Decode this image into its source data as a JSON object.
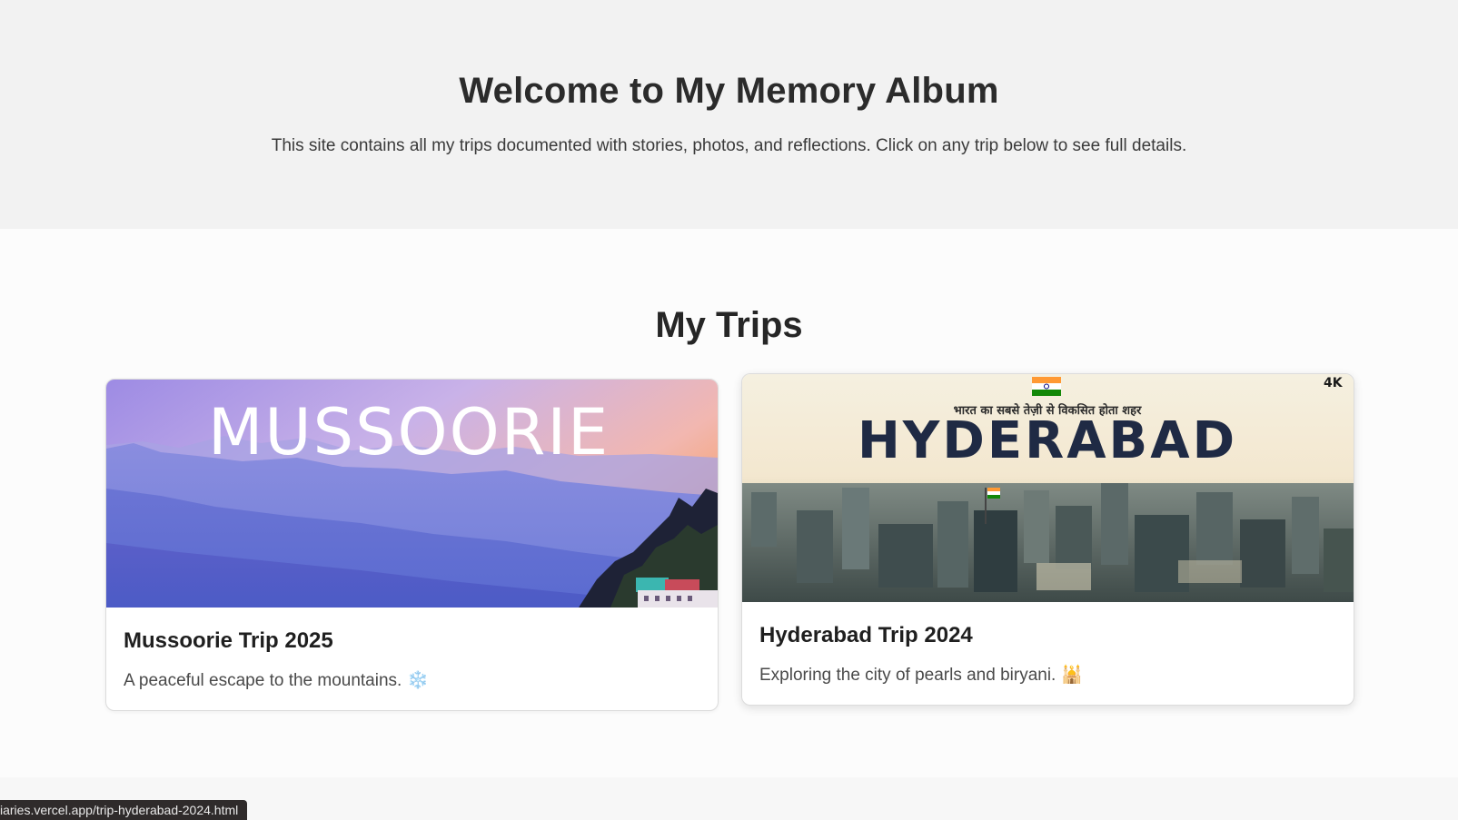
{
  "hero": {
    "title": "Welcome to My Memory Album",
    "subtitle": "This site contains all my trips documented with stories, photos, and reflections. Click on any trip below to see full details."
  },
  "trips_section": {
    "title": "My Trips",
    "trips": [
      {
        "title": "Mussoorie Trip 2025",
        "description": "A peaceful escape to the mountains.",
        "emoji": "❄️",
        "image_text": "MUSSOORIE"
      },
      {
        "title": "Hyderabad Trip 2024",
        "description": "Exploring the city of pearls and biryani.",
        "emoji": "🕌",
        "image_text": "HYDERABAD",
        "image_subtext": "भारत का सबसे तेज़ी से विकसित होता शहर",
        "image_badge": "4K"
      }
    ]
  },
  "status_bar": {
    "url": "iaries.vercel.app/trip-hyderabad-2024.html"
  }
}
